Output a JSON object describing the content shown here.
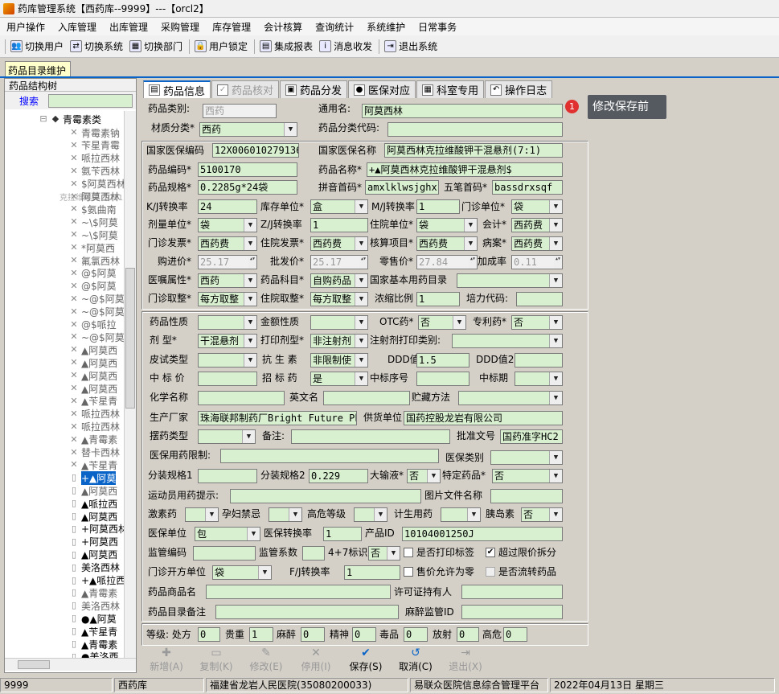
{
  "window": {
    "title": "药库管理系统【西药库--9999】---【orcl2】"
  },
  "menu": [
    "用户操作",
    "入库管理",
    "出库管理",
    "采购管理",
    "库存管理",
    "会计核算",
    "查询统计",
    "系统维护",
    "日常事务"
  ],
  "toolbar": [
    "切换用户",
    "切换系统",
    "切换部门",
    "用户锁定",
    "集成报表",
    "消息收发",
    "退出系统"
  ],
  "doc_tab": "药品目录维护",
  "tree": {
    "header": "药品结构树",
    "search_label": "搜索",
    "root": "青霉素类",
    "watermark": "克拉维酸钾【01170056】",
    "items": [
      "青霉素钠",
      "苄星青霉",
      "哌拉西林",
      "氨苄西林",
      "$阿莫西林",
      "阿莫西林",
      "$氨曲南",
      "~\\$阿莫",
      "~\\$阿莫",
      "*阿莫西",
      "氟氯西林",
      "@$阿莫",
      "@$阿莫",
      "~@$阿莫",
      "~@$阿莫",
      "@$哌拉",
      "~@$阿莫",
      "▲阿莫西",
      "▲阿莫西",
      "▲阿莫西",
      "▲阿莫西",
      "▲苄星青",
      "哌拉西林",
      "哌拉西林",
      "▲青霉素",
      "替卡西林",
      "▲苄星青",
      "+▲阿莫",
      "▲阿莫西",
      "▲哌拉西",
      "▲阿莫西",
      "+阿莫西林",
      "+阿莫西",
      "▲阿莫西",
      "美洛西林",
      "+▲哌拉西",
      "▲青霉素",
      "美洛西林",
      "●▲阿莫",
      "▲苄星青",
      "▲青霉素",
      "●美洛西",
      "●▲苄星"
    ]
  },
  "tabs": [
    "药品信息",
    "药品核对",
    "药品分发",
    "医保对应",
    "科室专用",
    "操作日志"
  ],
  "tooltip": {
    "badge": "1",
    "text": "修改保存前"
  },
  "form": {
    "药品类别": "西药",
    "通用名": "阿莫西林",
    "材质分类": "西药",
    "药品分类代码": "",
    "国家医保编码": "12X006010279136",
    "国家医保名称": "阿莫西林克拉维酸钾干混悬剂(7:1)",
    "药品编码": "5100170",
    "药品名称": "+▲阿莫西林克拉维酸钾干混悬剂$",
    "药品规格": "0.2285g*24袋",
    "拼音首码": "amxlklwsjghx",
    "五笔首码": "bassdrxsqf",
    "KJ转换率": "24",
    "库存单位": "盒",
    "MJ转换率": "1",
    "门诊单位": "袋",
    "剂量单位": "袋",
    "ZJ转换率": "1",
    "住院单位": "袋",
    "会计": "西药费",
    "门诊发票": "西药费",
    "住院发票": "西药费",
    "核算项目": "西药费",
    "病案": "西药费",
    "购进价": "25.17",
    "批发价": "25.17",
    "零售价": "27.84",
    "加成率": "0.11",
    "医嘱属性": "西药",
    "药品科目": "自购药品",
    "国家基本用药目录": "",
    "门诊取整": "每方取整",
    "住院取整": "每方取整",
    "浓缩比例": "1",
    "培力代码": "",
    "药品性质": "",
    "金额性质": "",
    "OTC药": "否",
    "专利药": "否",
    "剂型": "干混悬剂",
    "打印剂型": "非注射剂",
    "注射剂打印类别": "",
    "皮试类型": "",
    "抗生素": "非限制使",
    "DDD值": "1.5",
    "DDD值2": "",
    "中标价": "",
    "招标药": "是",
    "中标序号": "",
    "中标期": "",
    "化学名称": "",
    "英文名": "",
    "贮藏方法": "",
    "生产厂家": "珠海联邦制药厂Bright Future Pharm",
    "供货单位": "国药控股龙岩有限公司",
    "摆药类型": "",
    "备注": "",
    "批准文号": "国药准字HC2",
    "医保用药限制": "",
    "医保类别": "",
    "分装规格1": "",
    "分装规格2": "0.229",
    "大输液": "否",
    "特定药品": "否",
    "运动员用药提示": "",
    "图片文件名称": "",
    "激素药": "",
    "孕妇禁忌": "",
    "高危等级": "",
    "计生用药": "",
    "胰岛素": "否",
    "医保单位": "包",
    "医保转换率": "1",
    "产品ID": "10104001250J",
    "监管编码": "",
    "监管系数": "",
    "4+7标识": "否",
    "门诊开方单位": "袋",
    "FJ转换率": "1",
    "药品商品名": "",
    "许可证持有人": "",
    "药品目录备注": "",
    "麻醉监管ID": "",
    "处方": "0",
    "贵重": "1",
    "麻醉": "0",
    "精神": "0",
    "毒品": "0",
    "放射": "0",
    "高危": "0"
  },
  "labels": {
    "l_药品类别": "药品类别:",
    "l_通用名": "通用名:",
    "l_材质分类": "材质分类*",
    "l_药品分类代码": "药品分类代码:",
    "l_国家医保编码": "国家医保编码",
    "l_国家医保名称": "国家医保名称",
    "l_药品编码": "药品编码*",
    "l_药品名称": "药品名称*",
    "l_药品规格": "药品规格*",
    "l_拼音首码": "拼音首码*",
    "l_五笔首码": "五笔首码*",
    "l_KJ": "K/J转换率",
    "l_库存单位": "库存单位*",
    "l_MJ": "M/J转换率",
    "l_门诊单位": "门诊单位*",
    "l_剂量单位": "剂量单位*",
    "l_ZJ": "Z/J转换率",
    "l_住院单位": "住院单位*",
    "l_会计": "会计*",
    "l_门诊发票": "门诊发票*",
    "l_住院发票": "住院发票*",
    "l_核算项目": "核算项目*",
    "l_病案": "病案*",
    "l_购进价": "购进价*",
    "l_批发价": "批发价*",
    "l_零售价": "零售价*",
    "l_加成率": "加成率",
    "l_医嘱属性": "医嘱属性*",
    "l_药品科目": "药品科目*",
    "l_国家基本用药目录": "国家基本用药目录",
    "l_门诊取整": "门诊取整*",
    "l_住院取整": "住院取整*",
    "l_浓缩比例": "浓缩比例",
    "l_培力代码": "培力代码:",
    "l_药品性质": "药品性质",
    "l_金额性质": "金额性质",
    "l_OTC": "OTC药*",
    "l_专利药": "专利药*",
    "l_剂型": "剂  型*",
    "l_打印剂型": "打印剂型*",
    "l_注射剂打印类别": "注射剂打印类别:",
    "l_皮试类型": "皮试类型",
    "l_抗生素": "抗 生 素",
    "l_DDD值": "DDD值",
    "l_DDD值2": "DDD值2",
    "l_中标价": "中 标 价",
    "l_招标药": "招 标 药",
    "l_中标序号": "中标序号",
    "l_中标期": "中标期",
    "l_化学名称": "化学名称",
    "l_英文名": "英文名",
    "l_贮藏方法": "贮藏方法",
    "l_生产厂家": "生产厂家",
    "l_供货单位": "供货单位",
    "l_摆药类型": "摆药类型",
    "l_备注": "备注:",
    "l_批准文号": "批准文号",
    "l_医保用药限制": "医保用药限制:",
    "l_医保类别": "医保类别",
    "l_分装规格1": "分装规格1",
    "l_分装规格2": "分装规格2",
    "l_大输液": "大输液*",
    "l_特定药品": "特定药品*",
    "l_运动员用药提示": "运动员用药提示:",
    "l_图片文件名称": "图片文件名称",
    "l_激素药": "激素药",
    "l_孕妇禁忌": "孕妇禁忌",
    "l_高危等级": "高危等级",
    "l_计生用药": "计生用药",
    "l_胰岛素": "胰岛素",
    "l_医保单位": "医保单位",
    "l_医保转换率": "医保转换率",
    "l_产品ID": "产品ID",
    "l_监管编码": "监管编码",
    "l_监管系数": "监管系数",
    "l_4+7标识": "4+7标识",
    "l_是否打印标签": "是否打印标签",
    "l_超过限价拆分": "超过限价拆分",
    "l_门诊开方单位": "门诊开方单位",
    "l_FJ": "F/J转换率",
    "l_售价允许为零": "售价允许为零",
    "l_是否流转药品": "是否流转药品",
    "l_药品商品名": "药品商品名",
    "l_许可证持有人": "许可证持有人",
    "l_药品目录备注": "药品目录备注",
    "l_麻醉监管ID": "麻醉监管ID",
    "l_等级": "等级: 处方",
    "l_贵重": "贵重",
    "l_麻醉": "麻醉",
    "l_精神": "精神",
    "l_毒品": "毒品",
    "l_放射": "放射",
    "l_高危": "高危"
  },
  "checkboxes": {
    "是否打印标签": false,
    "超过限价拆分": true,
    "售价允许为零": false,
    "是否流转药品": false
  },
  "buttons": [
    "新增(A)",
    "复制(K)",
    "修改(E)",
    "停用(I)",
    "保存(S)",
    "取消(C)",
    "退出(X)"
  ],
  "status": [
    "9999",
    "西药库",
    "福建省龙岩人民医院(35080200033)",
    "易联众医院信息综合管理平台",
    "2022年04月13日  星期三"
  ]
}
